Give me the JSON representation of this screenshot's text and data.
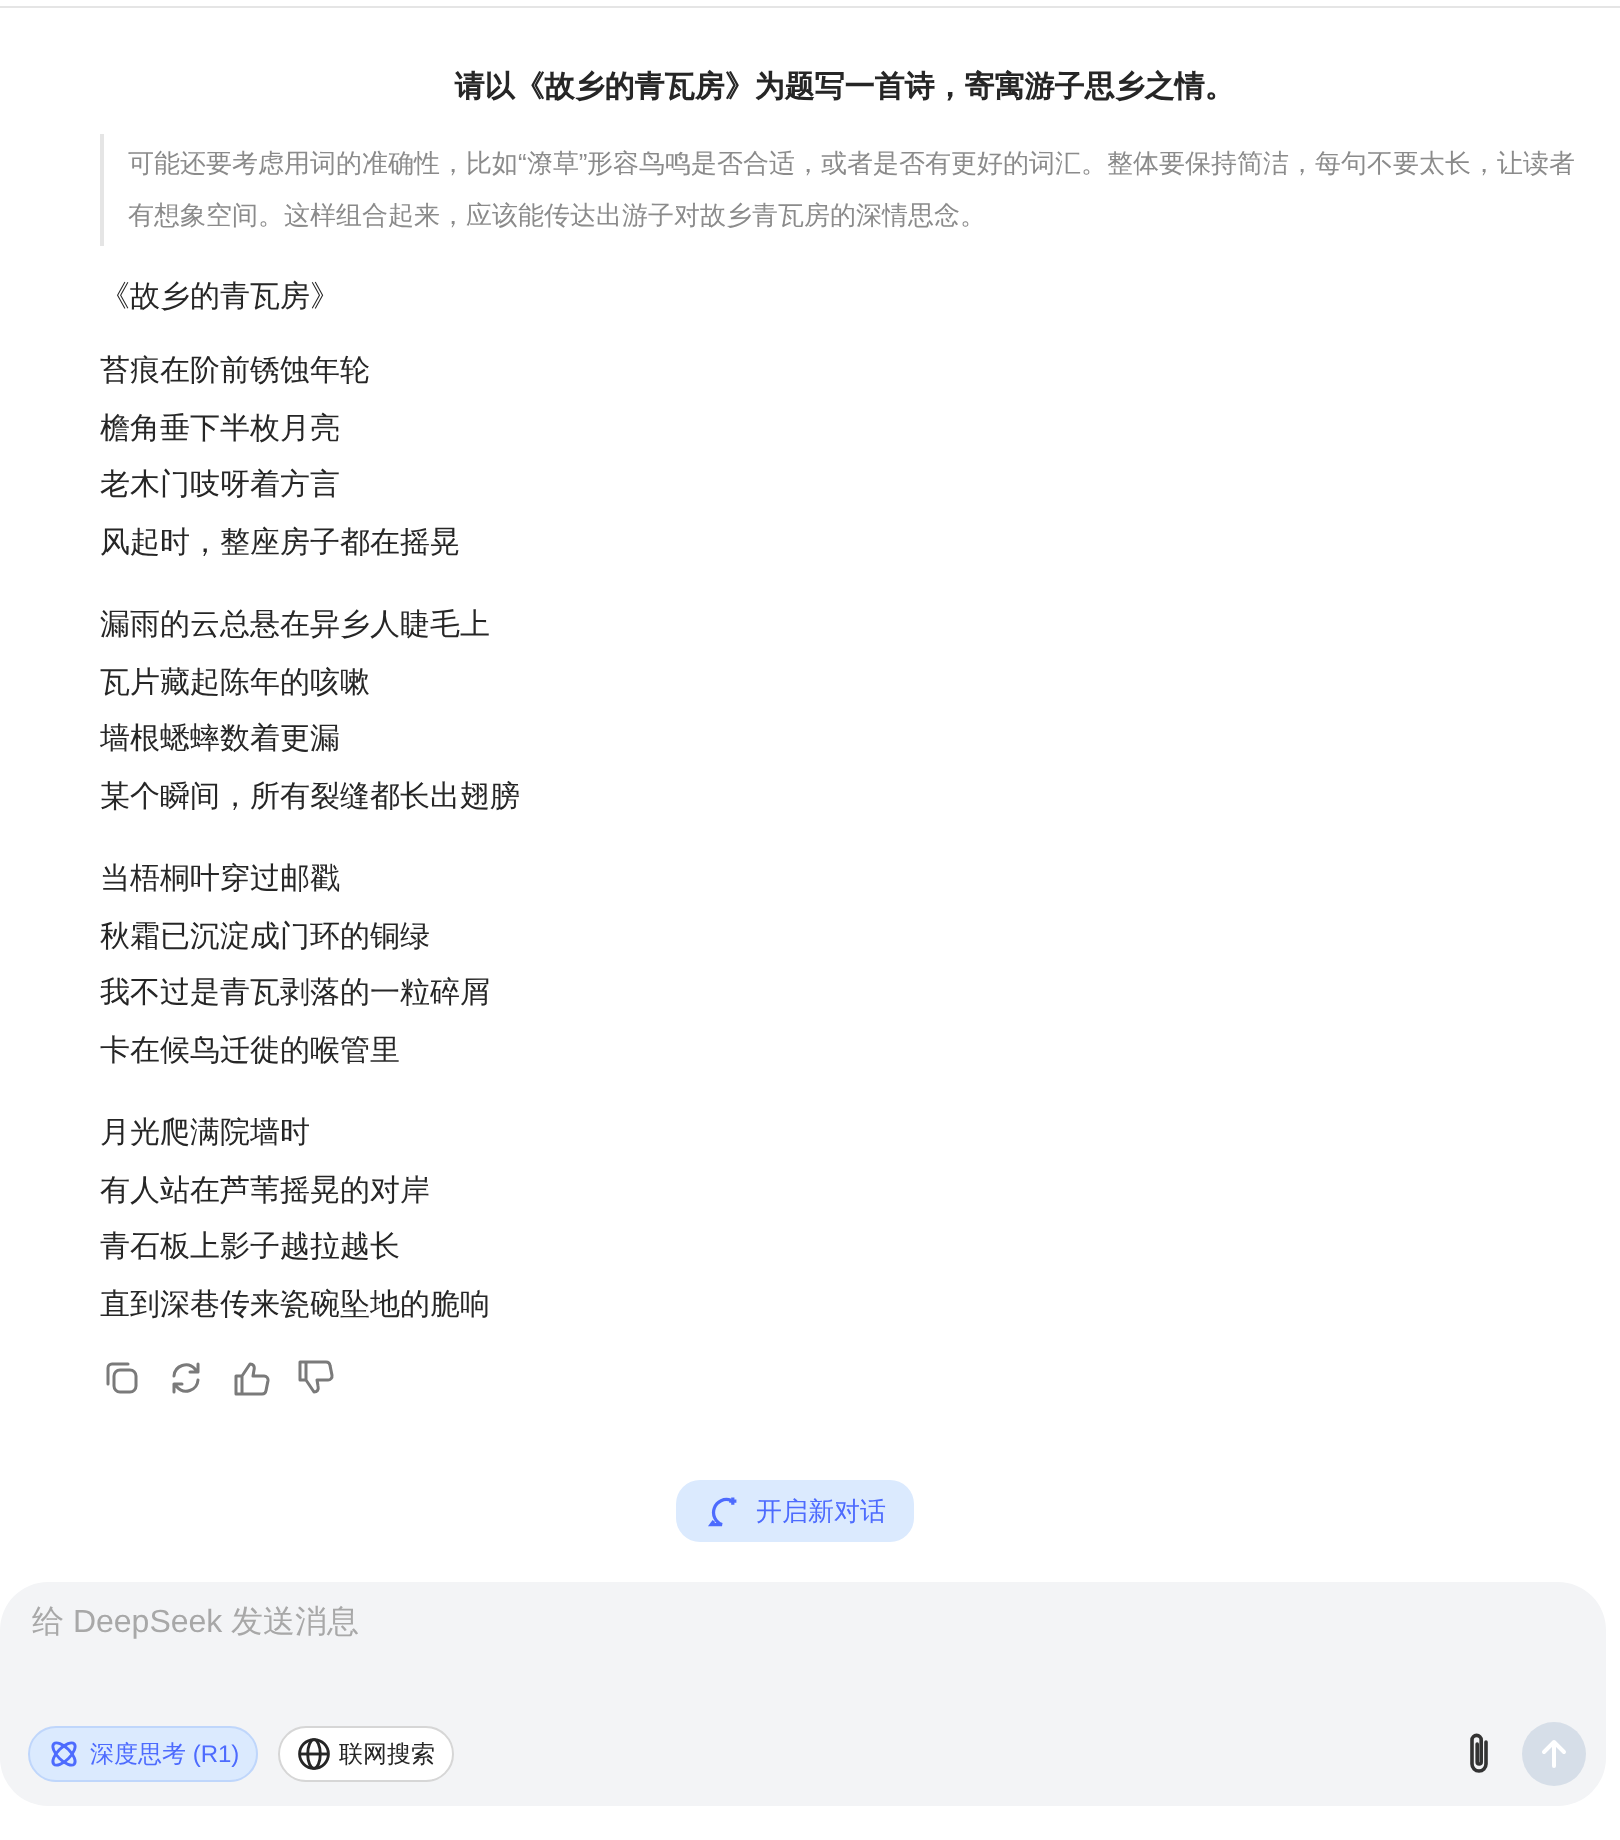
{
  "user_message": "请以《故乡的青瓦房》为题写一首诗，寄寓游子思乡之情。",
  "thinking": "可能还要考虑用词的准确性，比如“潦草”形容鸟鸣是否合适，或者是否有更好的词汇。整体要保持简洁，每句不要太长，让读者有想象空间。这样组合起来，应该能传达出游子对故乡青瓦房的深情思念。",
  "poem_title": "《故乡的青瓦房》",
  "stanzas": [
    [
      "苔痕在阶前锈蚀年轮",
      "檐角垂下半枚月亮",
      "老木门吱呀着方言",
      "风起时，整座房子都在摇晃"
    ],
    [
      "漏雨的云总悬在异乡人睫毛上",
      "瓦片藏起陈年的咳嗽",
      "墙根蟋蟀数着更漏",
      "某个瞬间，所有裂缝都长出翅膀"
    ],
    [
      "当梧桐叶穿过邮戳",
      "秋霜已沉淀成门环的铜绿",
      "我不过是青瓦剥落的一粒碎屑",
      "卡在候鸟迁徙的喉管里"
    ],
    [
      "月光爬满院墙时",
      "有人站在芦苇摇晃的对岸",
      "青石板上影子越拉越长",
      "直到深巷传来瓷碗坠地的脆响"
    ]
  ],
  "actions": [
    {
      "kind": "copy"
    },
    {
      "kind": "regenerate"
    },
    {
      "kind": "like"
    },
    {
      "kind": "dislike"
    }
  ],
  "new_chat_button": "开启新对话",
  "composer": {
    "placeholder": "给 DeepSeek 发送消息",
    "toggles": [
      {
        "kind": "deep_think",
        "label": "深度思考 (R1)",
        "selected": true
      },
      {
        "kind": "web_search",
        "label": "联网搜索",
        "selected": false
      }
    ],
    "send_disabled": true
  }
}
